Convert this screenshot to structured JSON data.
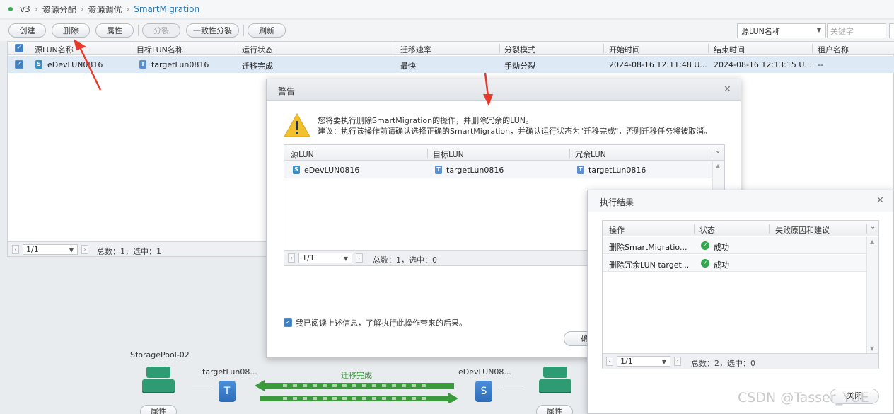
{
  "breadcrumb": [
    "v3",
    "资源分配",
    "资源调优",
    "SmartMigration"
  ],
  "toolbar": {
    "create": "创建",
    "delete": "删除",
    "properties": "属性",
    "split": "分裂",
    "consistent_split": "一致性分裂",
    "refresh": "刷新",
    "filter_field": "源LUN名称",
    "keyword_placeholder": "关键字"
  },
  "main_table": {
    "columns": [
      "源LUN名称",
      "目标LUN名称",
      "运行状态",
      "迁移速率",
      "分裂模式",
      "开始时间",
      "结束时间",
      "租户名称"
    ],
    "rows": [
      {
        "source": "eDevLUN0816",
        "target": "targetLun0816",
        "status": "迁移完成",
        "rate": "最快",
        "split_mode": "手动分裂",
        "start": "2024-08-16 12:11:48 U...",
        "end": "2024-08-16 12:13:15 U...",
        "tenant": "--"
      }
    ],
    "pager": {
      "page": "1/1",
      "summary": "总数：1，选中：1"
    }
  },
  "diagram": {
    "pool": "StoragePool-02",
    "target_lun": "targetLun08...",
    "source_lun": "eDevLUN08...",
    "migration_status": "迁移完成",
    "left_button": "属性",
    "right_button": "属性"
  },
  "warning_dialog": {
    "title": "警告",
    "message_line1": "您将要执行删除SmartMigration的操作，并删除冗余的LUN。",
    "message_line2": "建议：执行该操作前请确认选择正确的SmartMigration，并确认运行状态为\"迁移完成\"，否则迁移任务将被取消。",
    "columns": [
      "源LUN",
      "目标LUN",
      "冗余LUN"
    ],
    "rows": [
      {
        "source": "eDevLUN0816",
        "target": "targetLun0816",
        "redundant": "targetLun0816"
      }
    ],
    "pager": {
      "page": "1/1",
      "summary": "总数：1，选中：0"
    },
    "acknowledge": "我已阅读上述信息，了解执行此操作带来的后果。",
    "confirm_button": "确"
  },
  "result_dialog": {
    "title": "执行结果",
    "columns": [
      "操作",
      "状态",
      "失败原因和建议"
    ],
    "rows": [
      {
        "operation": "删除SmartMigratio...",
        "status": "成功"
      },
      {
        "operation": "删除冗余LUN target...",
        "status": "成功"
      }
    ],
    "pager": {
      "page": "1/1",
      "summary": "总数：2，选中：0"
    },
    "close_button": "关闭"
  },
  "watermark": "CSDN @Tasser_YUE",
  "colors": {
    "accent": "#2a7ab8",
    "success": "#35a64f",
    "annotation_arrow": "#e8392b",
    "migration_green": "#3b9a3b"
  }
}
